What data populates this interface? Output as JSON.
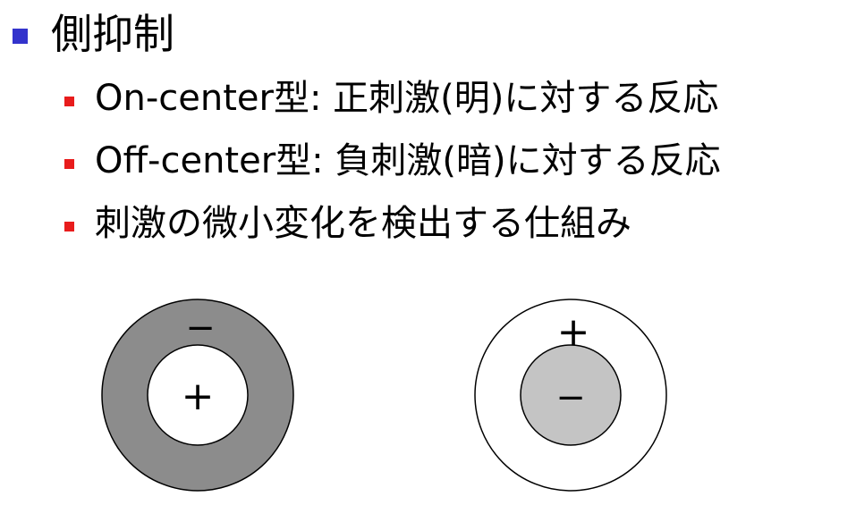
{
  "colors": {
    "bullet_level1": "#3333cc",
    "bullet_level2": "#e81c1c",
    "ring_dark": "#8c8c8c",
    "center_light": "#c4c4c4"
  },
  "title": "側抑制",
  "bullets": [
    {
      "text": "On-center型:  正刺激(明)に対する反応"
    },
    {
      "text": "Off-center型:  負刺激(暗)に対する反応"
    },
    {
      "text": "刺激の微小変化を検出する仕組み"
    }
  ],
  "diagram": {
    "on_center": {
      "surround_sign": "−",
      "center_sign": "+"
    },
    "off_center": {
      "surround_sign": "+",
      "center_sign": "−"
    }
  }
}
